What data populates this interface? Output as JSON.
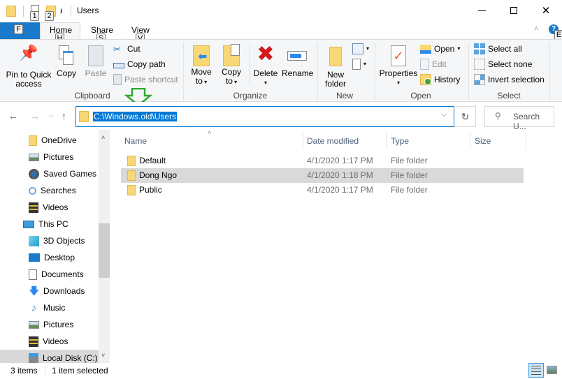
{
  "window": {
    "title": "Users",
    "minimize_icon": "minimize-icon",
    "maximize_icon": "maximize-icon",
    "close_icon": "close-icon"
  },
  "quick_access_toolbar": {
    "keytips": [
      "1",
      "2"
    ],
    "items": [
      "folder-icon",
      "properties-icon",
      "new-folder-icon",
      "customize-dropdown-icon"
    ]
  },
  "ribbon": {
    "file_tab": {
      "label": "F",
      "keytip": "F"
    },
    "tabs": [
      {
        "label": "Home",
        "keytip": "H",
        "active": true
      },
      {
        "label": "Share",
        "keytip": "S"
      },
      {
        "label": "View",
        "keytip": "V"
      }
    ],
    "help_keytip": "E",
    "groups": {
      "clipboard": {
        "label": "Clipboard",
        "pin": "Pin to Quick access",
        "pin_line1": "Pin to Quick",
        "pin_line2": "access",
        "copy": "Copy",
        "paste": "Paste",
        "cut": "Cut",
        "copy_path": "Copy path",
        "paste_shortcut": "Paste shortcut"
      },
      "organize": {
        "label": "Organize",
        "move_to_1": "Move",
        "move_to_2": "to",
        "copy_to_1": "Copy",
        "copy_to_2": "to",
        "delete": "Delete",
        "rename": "Rename"
      },
      "new": {
        "label": "New",
        "new_folder_1": "New",
        "new_folder_2": "folder"
      },
      "open": {
        "label": "Open",
        "properties": "Properties",
        "open": "Open",
        "edit": "Edit",
        "history": "History"
      },
      "select": {
        "label": "Select",
        "select_all": "Select all",
        "select_none": "Select none",
        "invert_selection": "Invert selection"
      }
    }
  },
  "address_bar": {
    "path": "C:\\Windows.old\\Users",
    "search_placeholder": "Search U...",
    "annotation": "green-down-arrow"
  },
  "nav_pane": {
    "items": [
      {
        "label": "OneDrive",
        "icon": "folder-icon",
        "indent": 2
      },
      {
        "label": "Pictures",
        "icon": "pictures-icon",
        "indent": 2
      },
      {
        "label": "Saved Games",
        "icon": "saved-games-icon",
        "indent": 2
      },
      {
        "label": "Searches",
        "icon": "search-icon",
        "indent": 2
      },
      {
        "label": "Videos",
        "icon": "videos-icon",
        "indent": 2
      },
      {
        "label": "This PC",
        "icon": "computer-icon",
        "indent": 1
      },
      {
        "label": "3D Objects",
        "icon": "3d-objects-icon",
        "indent": 2
      },
      {
        "label": "Desktop",
        "icon": "desktop-icon",
        "indent": 2
      },
      {
        "label": "Documents",
        "icon": "documents-icon",
        "indent": 2
      },
      {
        "label": "Downloads",
        "icon": "downloads-icon",
        "indent": 2
      },
      {
        "label": "Music",
        "icon": "music-icon",
        "indent": 2
      },
      {
        "label": "Pictures",
        "icon": "pictures-icon",
        "indent": 2
      },
      {
        "label": "Videos",
        "icon": "videos-icon",
        "indent": 2
      },
      {
        "label": "Local Disk (C:)",
        "icon": "drive-icon",
        "indent": 2,
        "selected": true
      }
    ]
  },
  "file_list": {
    "columns": [
      "Name",
      "Date modified",
      "Type",
      "Size"
    ],
    "rows": [
      {
        "name": "Default",
        "date": "4/1/2020 1:17 PM",
        "type": "File folder",
        "size": ""
      },
      {
        "name": "Dong Ngo",
        "date": "4/1/2020 1:18 PM",
        "type": "File folder",
        "size": "",
        "selected": true
      },
      {
        "name": "Public",
        "date": "4/1/2020 1:17 PM",
        "type": "File folder",
        "size": ""
      }
    ]
  },
  "status_bar": {
    "item_count": "3 items",
    "selection": "1 item selected"
  },
  "colors": {
    "accent": "#0078d7",
    "file_tab": "#1979ca",
    "selection": "#d9d9d9",
    "folder": "#f8d775",
    "annotation_arrow": "#2ea82e"
  }
}
